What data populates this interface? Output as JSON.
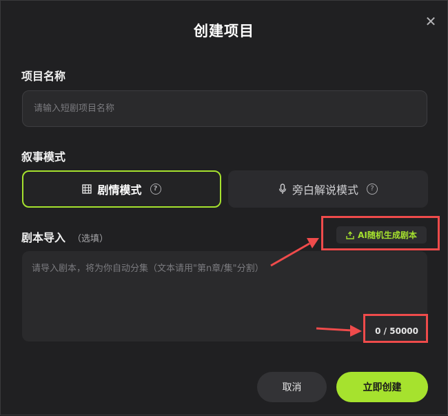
{
  "dialog": {
    "title": "创建项目",
    "close_symbol": "✕"
  },
  "project_name": {
    "label": "项目名称",
    "placeholder": "请输入短剧项目名称",
    "value": ""
  },
  "narrative": {
    "label": "叙事模式",
    "modes": [
      {
        "label": "剧情模式",
        "icon": "film-icon",
        "selected": true
      },
      {
        "label": "旁白解说模式",
        "icon": "microphone-icon",
        "selected": false
      }
    ],
    "help_symbol": "?"
  },
  "script_import": {
    "label": "剧本导入",
    "optional": "（选填）",
    "ai_button": "AI随机生成剧本",
    "placeholder": "请导入剧本，将为你自动分集（文本请用\"第n章/集\"分割）",
    "counter": "0 / 50000"
  },
  "footer": {
    "cancel": "取消",
    "create": "立即创建"
  },
  "colors": {
    "accent": "#a6e22e",
    "annotation": "#ef4b4b",
    "background": "#202022"
  }
}
